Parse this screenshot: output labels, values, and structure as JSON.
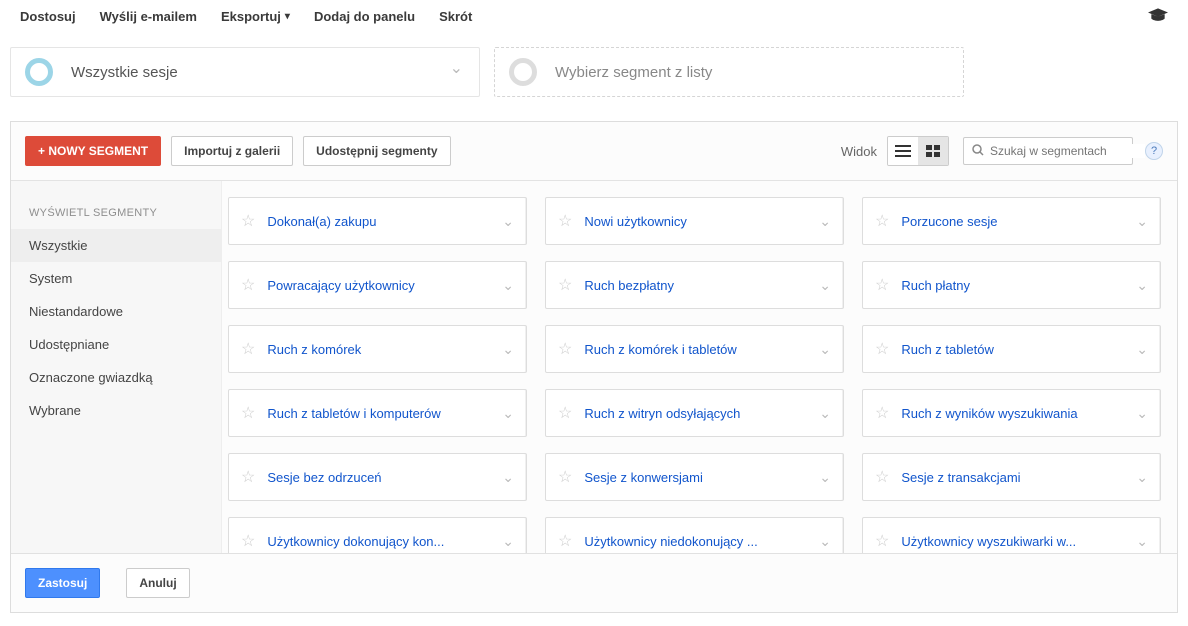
{
  "topMenu": {
    "customize": "Dostosuj",
    "email": "Wyślij e-mailem",
    "export": "Eksportuj",
    "addToPanel": "Dodaj do panelu",
    "shortcut": "Skrót"
  },
  "segmentPills": {
    "allSessions": "Wszystkie sesje",
    "chooseFromList": "Wybierz segment z listy"
  },
  "toolbar": {
    "newSegment": "+ NOWY SEGMENT",
    "importGallery": "Importuj z galerii",
    "share": "Udostępnij segmenty",
    "viewLabel": "Widok",
    "searchPlaceholder": "Szukaj w segmentach"
  },
  "sidebar": {
    "header": "WYŚWIETL SEGMENTY",
    "items": [
      "Wszystkie",
      "System",
      "Niestandardowe",
      "Udostępniane",
      "Oznaczone gwiazdką",
      "Wybrane"
    ],
    "activeIndex": 0
  },
  "segments": [
    "Dokonał(a) zakupu",
    "Nowi użytkownicy",
    "Porzucone sesje",
    "Powracający użytkownicy",
    "Ruch bezpłatny",
    "Ruch płatny",
    "Ruch z komórek",
    "Ruch z komórek i tabletów",
    "Ruch z tabletów",
    "Ruch z tabletów i komputerów",
    "Ruch z witryn odsyłających",
    "Ruch z wyników wyszukiwania",
    "Sesje bez odrzuceń",
    "Sesje z konwersjami",
    "Sesje z transakcjami",
    "Użytkownicy dokonujący kon...",
    "Użytkownicy niedokonujący ...",
    "Użytkownicy wyszukiwarki w..."
  ],
  "footer": {
    "apply": "Zastosuj",
    "cancel": "Anuluj"
  }
}
